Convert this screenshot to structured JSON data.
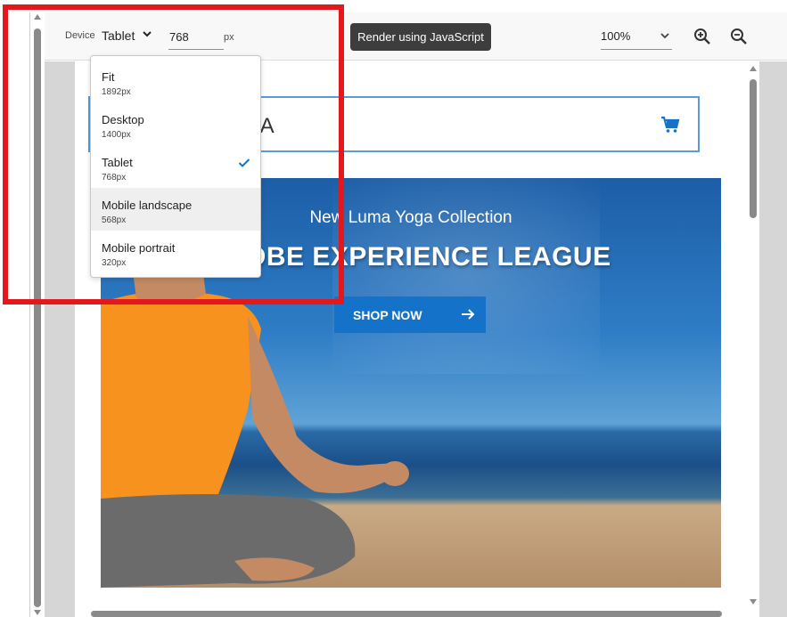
{
  "toolbar": {
    "device_label": "Device",
    "device_value": "Tablet",
    "width_value": "768",
    "width_unit": "px",
    "render_button": "Render using JavaScript",
    "zoom_value": "100%"
  },
  "dropdown": {
    "items": [
      {
        "name": "Fit",
        "size": "1892px"
      },
      {
        "name": "Desktop",
        "size": "1400px"
      },
      {
        "name": "Tablet",
        "size": "768px",
        "selected": true
      },
      {
        "name": "Mobile landscape",
        "size": "568px",
        "hovered": true
      },
      {
        "name": "Mobile portrait",
        "size": "320px"
      }
    ]
  },
  "preview": {
    "logo_partial": "IA",
    "hero_subtitle": "New Luma Yoga Collection",
    "hero_title": "OBE EXPERIENCE LEAGUE",
    "hero_cta": "SHOP NOW"
  },
  "icons": {
    "device_chevron": "chevron-down-icon",
    "zoom_chevron": "chevron-down-icon",
    "zoom_in": "zoom-in-icon",
    "zoom_out": "zoom-out-icon",
    "cart": "cart-icon",
    "check": "checkmark-icon",
    "cta_arrow": "arrow-right-icon"
  },
  "colors": {
    "highlight": "#e3171c",
    "accent": "#1473c9",
    "render_button_bg": "#3d3d3d",
    "header_border": "#5b9bd5"
  }
}
